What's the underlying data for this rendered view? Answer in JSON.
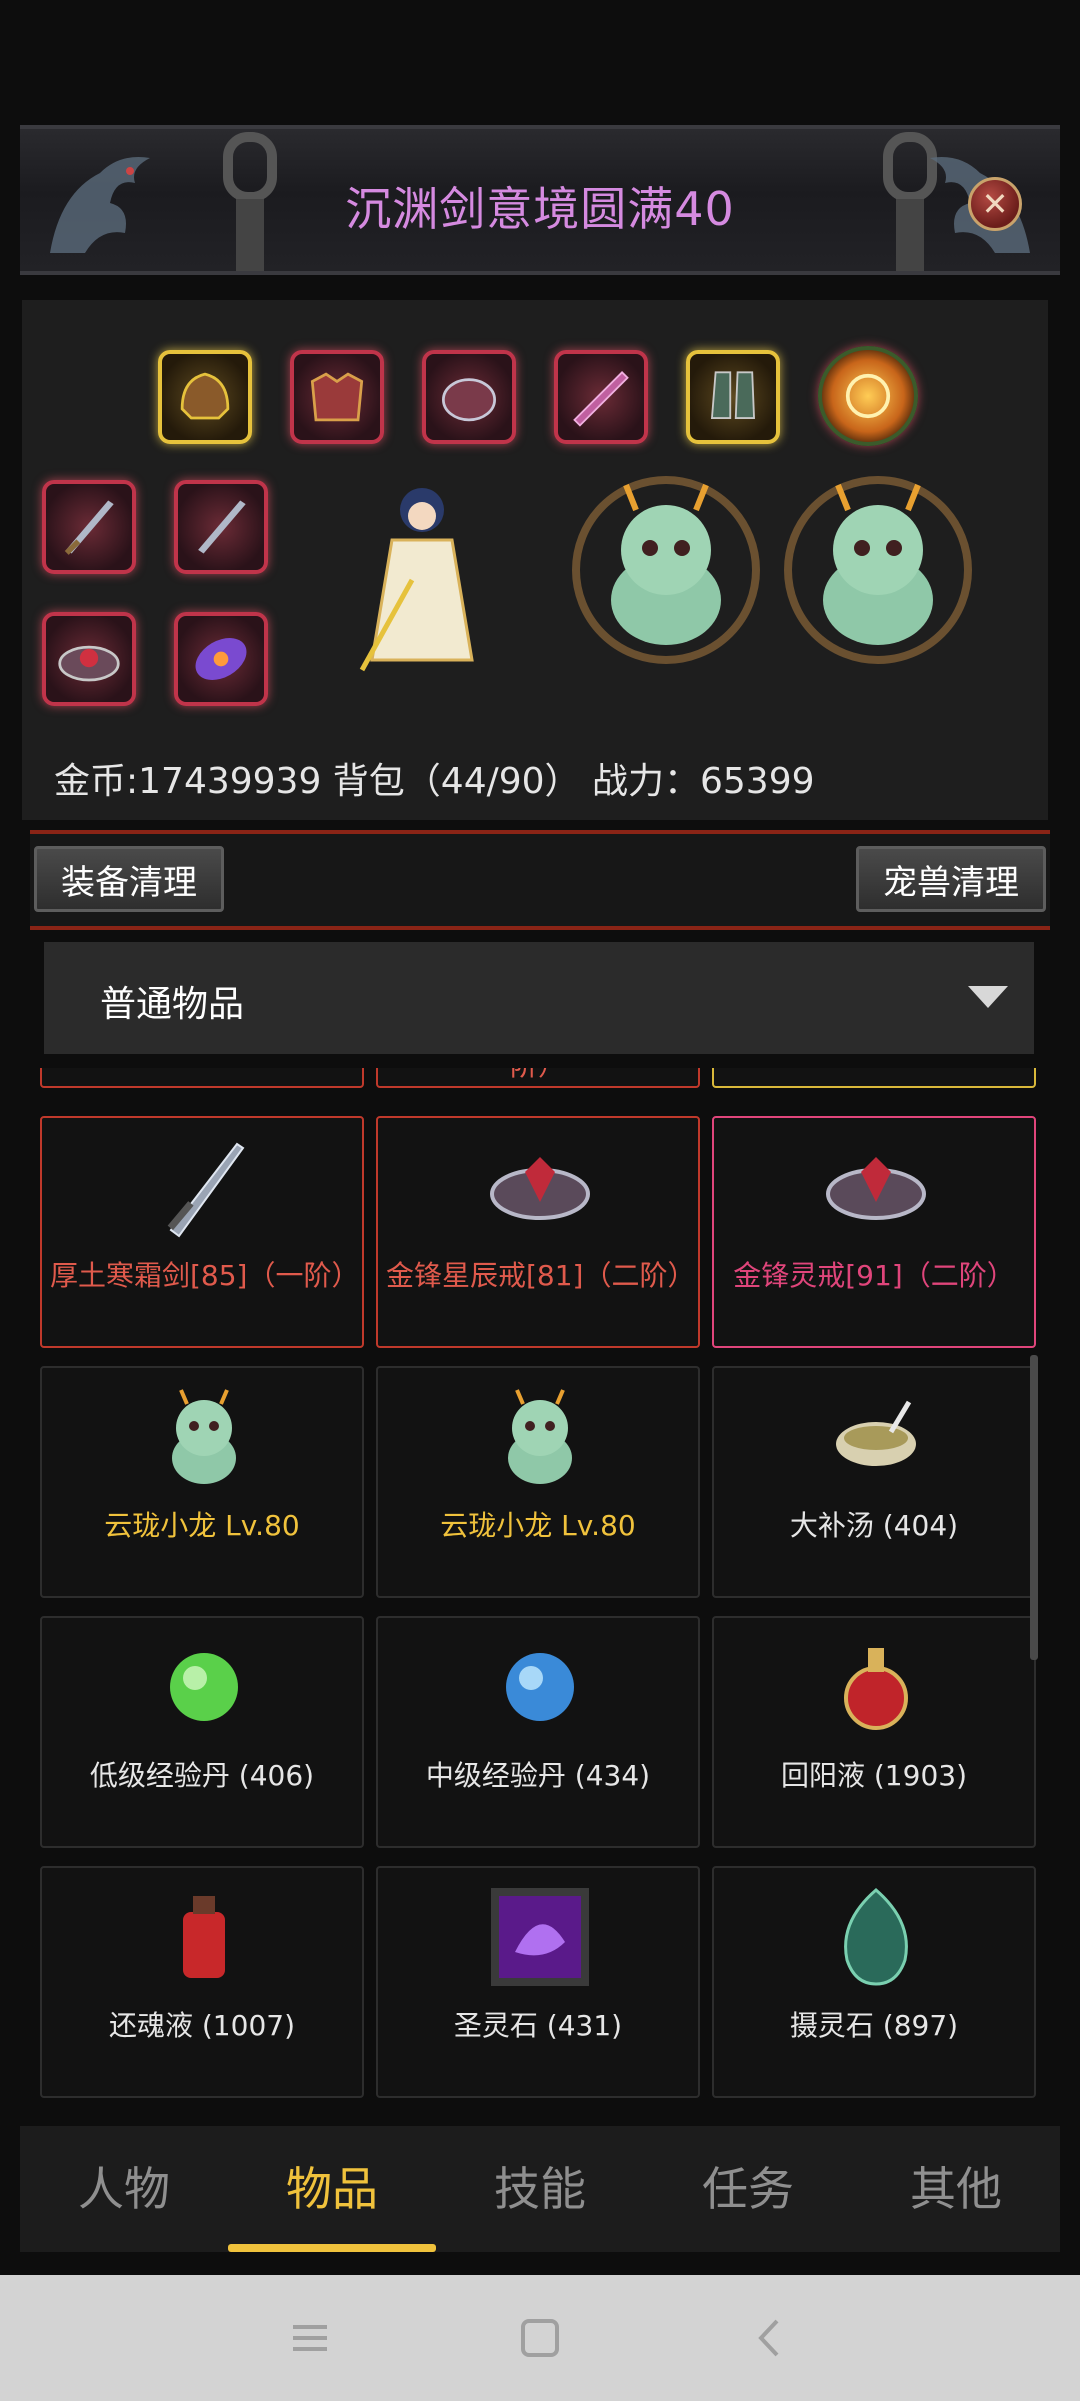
{
  "header": {
    "title": "沉渊剑意境圆满40"
  },
  "character": {
    "stats_line": "金币:17439939 背包（44/90） 战力：65399"
  },
  "actions": {
    "equip_cleanup": "装备清理",
    "pet_cleanup": "宠兽清理"
  },
  "filter": {
    "selected": "普通物品"
  },
  "items": {
    "partial_row_label": "阶）",
    "rows": [
      [
        {
          "label": "厚土寒霜剑[85]（一阶）",
          "color": "#e05a4c",
          "icon": "sword-icon"
        },
        {
          "label": "金锋星辰戒[81]（二阶）",
          "color": "#e05a4c",
          "icon": "ring-icon"
        },
        {
          "label": "金锋灵戒[91]（二阶）",
          "color": "#e0457b",
          "icon": "ring-icon"
        }
      ],
      [
        {
          "label": "云珑小龙 Lv.80",
          "color": "#f0c23c",
          "icon": "dragon-pet-icon"
        },
        {
          "label": "云珑小龙 Lv.80",
          "color": "#f0c23c",
          "icon": "dragon-pet-icon"
        },
        {
          "label": "大补汤 (404)",
          "color": "#e6e6e6",
          "icon": "soup-bowl-icon"
        }
      ],
      [
        {
          "label": "低级经验丹 (406)",
          "color": "#e6e6e6",
          "icon": "green-orb-icon"
        },
        {
          "label": "中级经验丹 (434)",
          "color": "#e6e6e6",
          "icon": "blue-orb-icon"
        },
        {
          "label": "回阳液 (1903)",
          "color": "#e6e6e6",
          "icon": "red-potion-icon"
        }
      ],
      [
        {
          "label": "还魂液 (1007)",
          "color": "#e6e6e6",
          "icon": "red-bottle-icon"
        },
        {
          "label": "圣灵石 (431)",
          "color": "#e6e6e6",
          "icon": "purple-stone-icon"
        },
        {
          "label": "摄灵石 (897)",
          "color": "#e6e6e6",
          "icon": "green-egg-stone-icon"
        }
      ]
    ]
  },
  "nav": {
    "tabs": [
      "人物",
      "物品",
      "技能",
      "任务",
      "其他"
    ],
    "active_index": 1,
    "accent": "#f0c23c"
  }
}
